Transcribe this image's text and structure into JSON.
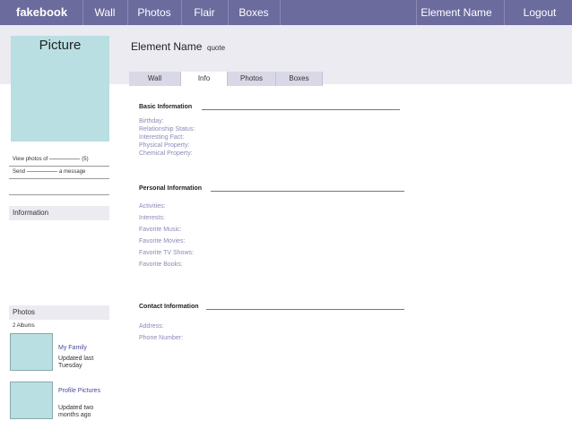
{
  "nav": {
    "brand": "fakebook",
    "items": [
      "Wall",
      "Photos",
      "Flair",
      "Boxes"
    ],
    "element_name": "Element Name",
    "logout": "Logout"
  },
  "profile": {
    "picture_label": "Picture",
    "name": "Element Name",
    "quote": "quote"
  },
  "sidebar": {
    "view_photos_prefix": "View photos of",
    "view_photos_count": "(5)",
    "send_prefix": "Send",
    "send_suffix": "a message",
    "information_header": "Information",
    "photos_header": "Photos",
    "albums_count": "2 Albums",
    "albums": [
      {
        "name": "My Family",
        "updated": "Updated last Tuesday"
      },
      {
        "name": "Profile Pictures",
        "updated": "Updated two months ago"
      }
    ]
  },
  "tabs": [
    "Wall",
    "Info",
    "Photos",
    "Boxes"
  ],
  "active_tab": "Info",
  "basic": {
    "title": "Basic Information",
    "fields": [
      "Birthday:",
      "Relationship Status:",
      "Interesting Fact:",
      "Physical Property:",
      "Chemical Property:"
    ]
  },
  "personal": {
    "title": "Personal Information",
    "fields": [
      "Activities:",
      "Interests:",
      "Favorite Music:",
      "Favorite Movies:",
      "Favorite TV Shows:",
      "Favorite Books:"
    ]
  },
  "contact": {
    "title": "Contact Information",
    "fields": [
      "Address:",
      "Phone Number:"
    ]
  },
  "colors": {
    "nav_bg": "#6b6b9e",
    "band_bg": "#ebebf1",
    "picture_bg": "#b9dfe2",
    "field_text": "#8a8ab8"
  }
}
